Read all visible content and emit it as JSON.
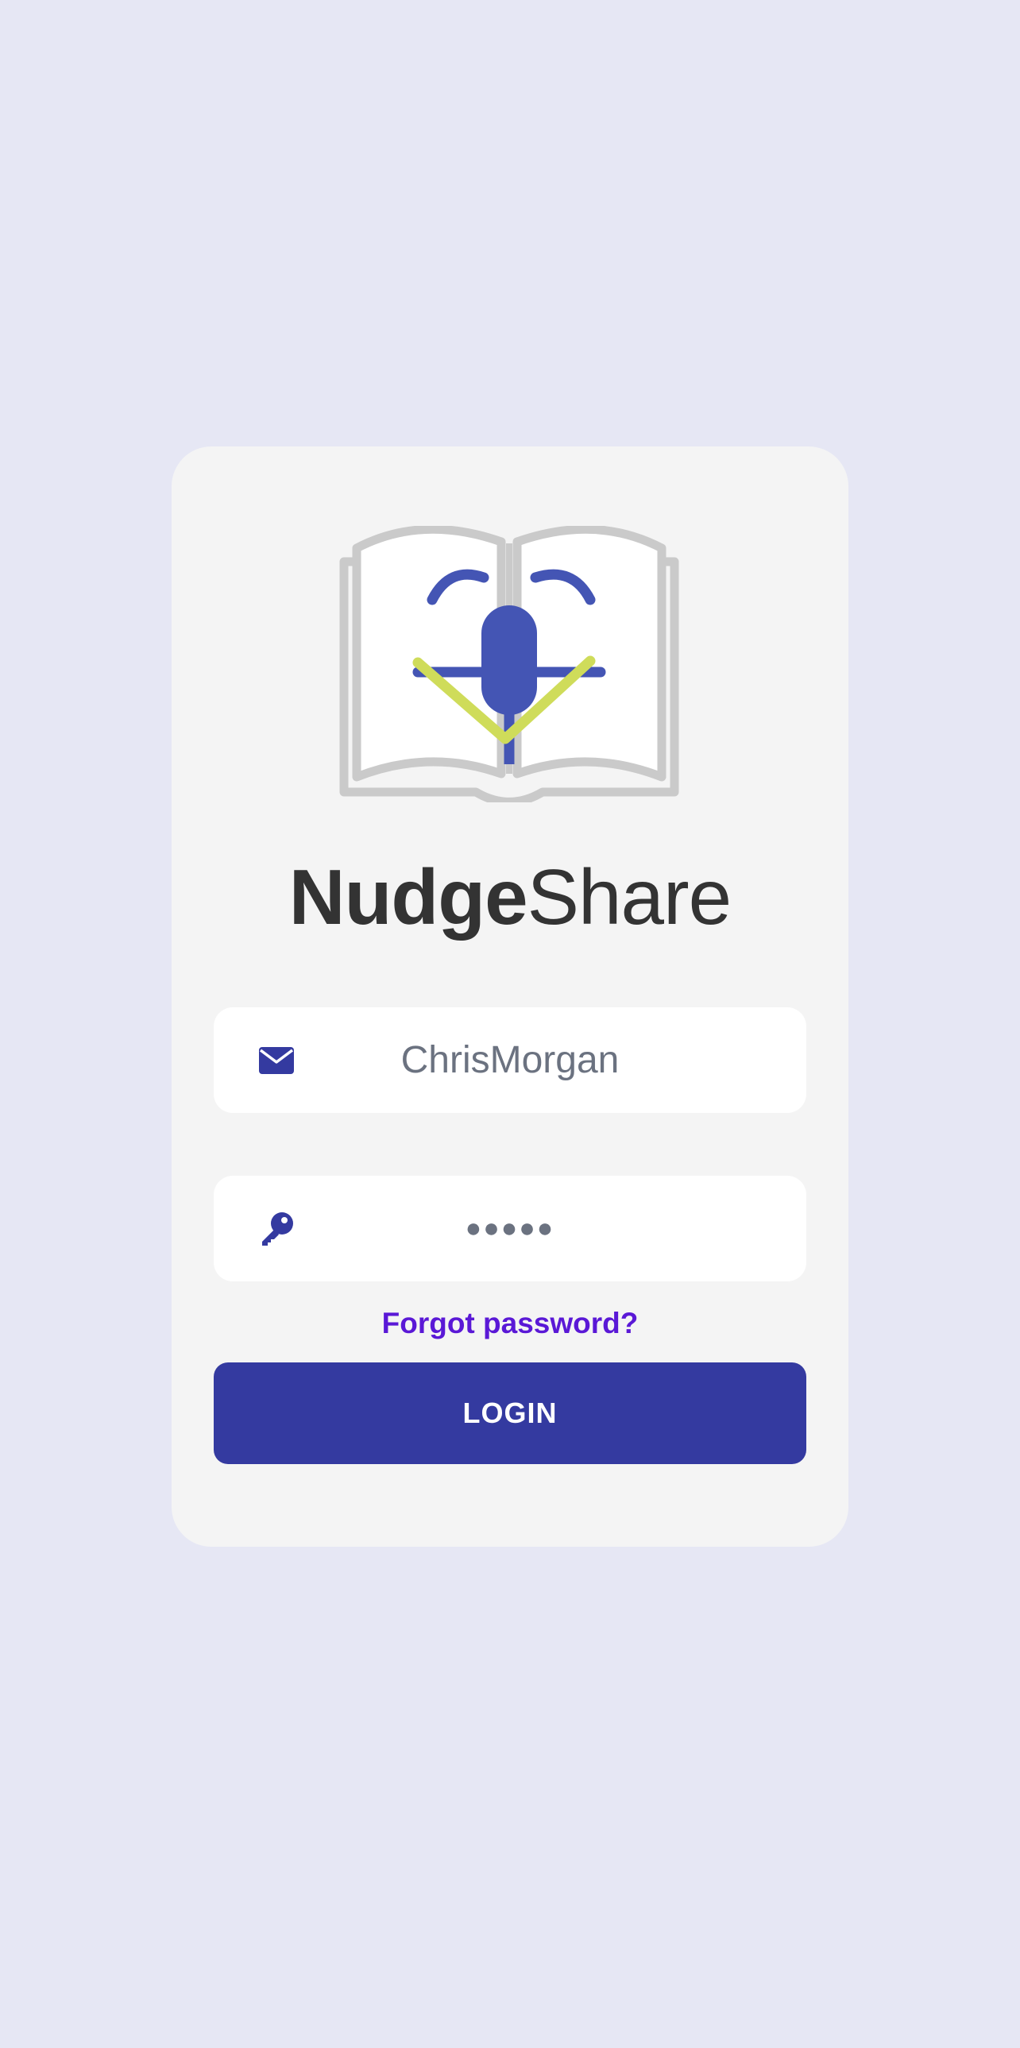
{
  "colors": {
    "background": "#e6e7f4",
    "card": "#f4f4f4",
    "accent": "#343aa0",
    "link": "#5a18d6",
    "logo_blue": "#4455b4",
    "logo_green": "#cfdc5a",
    "logo_gray": "#cacaca"
  },
  "brand": {
    "bold": "Nudge",
    "light": "Share",
    "logo_icon": "book-with-microphone-logo"
  },
  "form": {
    "username": {
      "icon": "envelope-icon",
      "value": "ChrisMorgan"
    },
    "password": {
      "icon": "key-icon",
      "masked_value": "●●●●●"
    },
    "forgot_label": "Forgot password?",
    "login_label": "LOGIN"
  }
}
